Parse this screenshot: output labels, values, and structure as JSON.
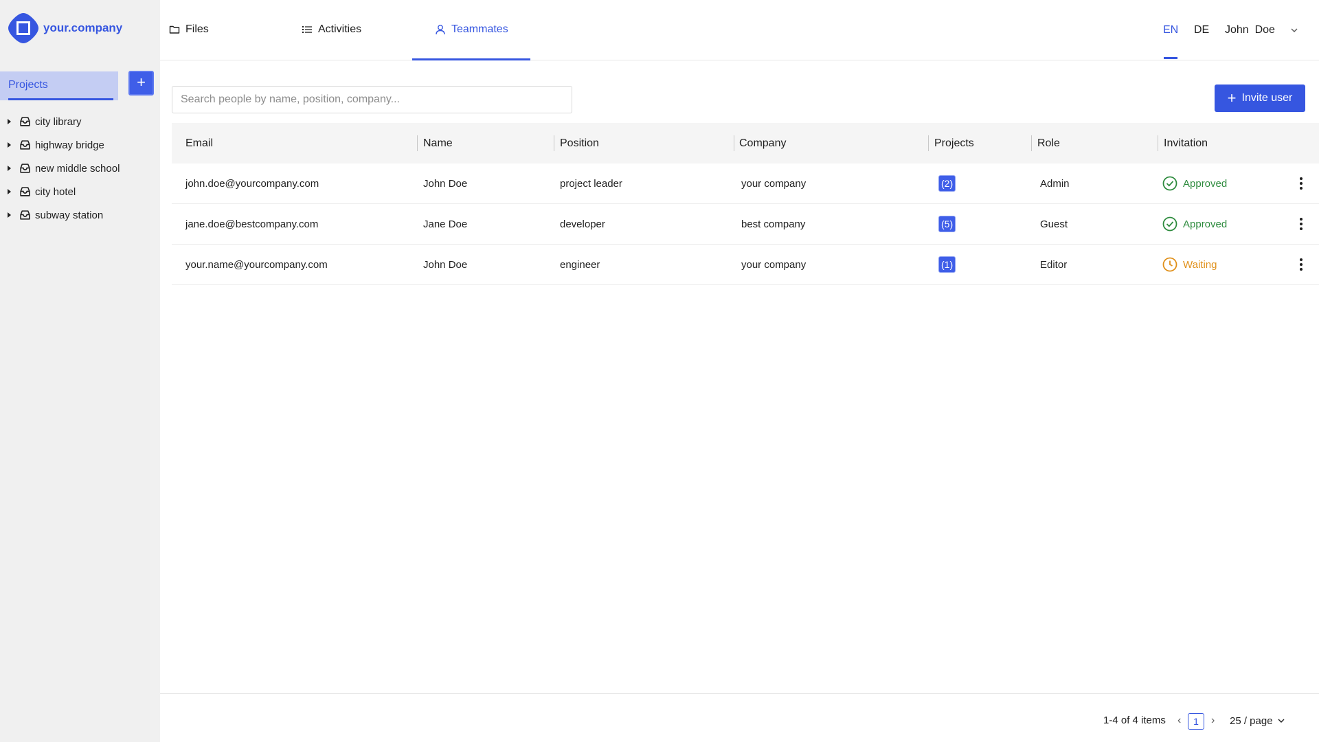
{
  "brand": {
    "name": "your.company",
    "color": "#3656e0"
  },
  "sidebar": {
    "tab_label": "Projects",
    "add_label": "+",
    "projects": [
      {
        "label": "city library"
      },
      {
        "label": "highway bridge"
      },
      {
        "label": "new middle school"
      },
      {
        "label": "city hotel"
      },
      {
        "label": "subway station"
      }
    ]
  },
  "nav": {
    "tabs": [
      {
        "label": "Files",
        "icon": "folder-icon"
      },
      {
        "label": "Activities",
        "icon": "list-icon"
      },
      {
        "label": "Teammates",
        "icon": "user-icon",
        "active": true
      }
    ],
    "languages": [
      "EN",
      "DE"
    ],
    "active_language": "EN",
    "user_name": "John  Doe"
  },
  "toolbar": {
    "search_placeholder": "Search people by name, position, company...",
    "invite_label": "Invite user"
  },
  "table": {
    "columns": [
      "Email",
      "Name",
      "Position",
      "Company",
      "Projects",
      "Role",
      "Invitation"
    ],
    "rows": [
      {
        "email": "john.doe@yourcompany.com",
        "name": "John Doe",
        "position": "project leader",
        "company": "your company",
        "projects": "(2)",
        "role": "Admin",
        "invitation": "Approved",
        "status": "approved"
      },
      {
        "email": "jane.doe@bestcompany.com",
        "name": "Jane Doe",
        "position": "developer",
        "company": "best company",
        "projects": "(5)",
        "role": "Guest",
        "invitation": "Approved",
        "status": "approved"
      },
      {
        "email": "your.name@yourcompany.com",
        "name": "John Doe",
        "position": "engineer",
        "company": "your company",
        "projects": "(1)",
        "role": "Editor",
        "invitation": "Waiting",
        "status": "waiting"
      }
    ]
  },
  "pagination": {
    "summary": "1-4 of 4 items",
    "prev": "‹",
    "current_page": "1",
    "next": "›",
    "page_size": "25 / page"
  },
  "colors": {
    "accent": "#3656e0",
    "approved": "#2e8b3e",
    "waiting": "#e0901a"
  }
}
